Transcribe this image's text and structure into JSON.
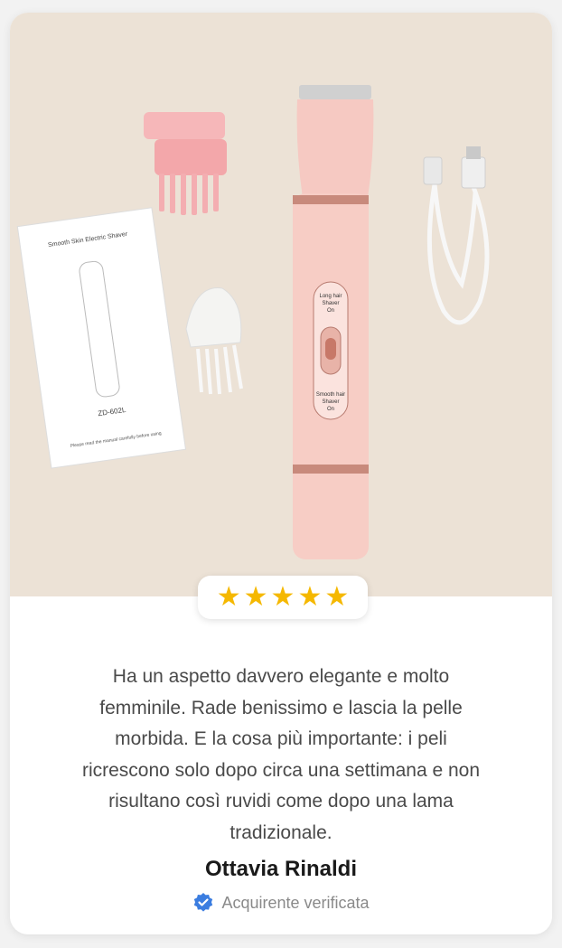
{
  "product_image": {
    "manual_title": "Smooth Skin Electric Shaver",
    "manual_model": "ZD-602L",
    "manual_footer": "Please read the manual carefully before using",
    "switch_top_label": [
      "Long hair",
      "Shaver",
      "On"
    ],
    "switch_bottom_label": [
      "Smooth hair",
      "Shaver",
      "On"
    ]
  },
  "review": {
    "rating": 5,
    "stars": [
      "★",
      "★",
      "★",
      "★",
      "★"
    ],
    "text_lines": [
      "Ha un aspetto davvero elegante e molto",
      "femminile. Rade benissimo e lascia la pelle",
      "morbida. E la cosa più importante: i peli",
      "ricrescono solo dopo circa una settimana e non",
      "risultano così ruvidi come dopo una lama",
      "tradizionale."
    ],
    "author": "Ottavia Rinaldi",
    "verified_label": "Acquirente verificata"
  },
  "colors": {
    "star": "#f5b800",
    "verified_badge": "#3b7de0",
    "background": "#ece2d6"
  }
}
